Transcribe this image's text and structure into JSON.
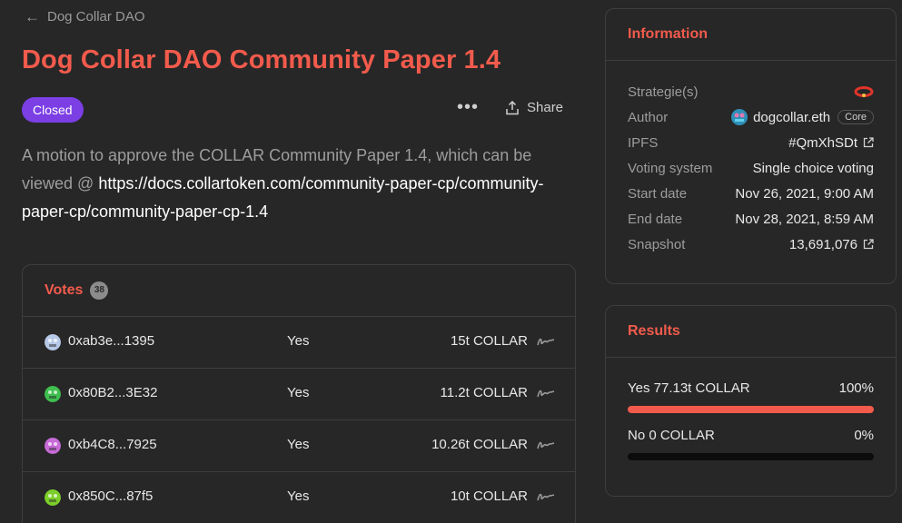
{
  "nav": {
    "back_label": "Dog Collar DAO"
  },
  "proposal": {
    "title": "Dog Collar DAO Community Paper 1.4",
    "status": "Closed",
    "more_label": "•••",
    "share_label": "Share",
    "description_text": "A motion to approve the COLLAR Community Paper 1.4, which can be viewed @ ",
    "description_link": "https://docs.collartoken.com/community-paper-cp/community-paper-cp/community-paper-cp-1.4"
  },
  "votes": {
    "title": "Votes",
    "count": "38",
    "rows": [
      {
        "address": "0xab3e...1395",
        "choice": "Yes",
        "amount": "15t COLLAR",
        "avatar_color": "#b7c9e8"
      },
      {
        "address": "0x80B2...3E32",
        "choice": "Yes",
        "amount": "11.2t COLLAR",
        "avatar_color": "#3fbf4f"
      },
      {
        "address": "0xb4C8...7925",
        "choice": "Yes",
        "amount": "10.26t COLLAR",
        "avatar_color": "#c86ad8"
      },
      {
        "address": "0x850C...87f5",
        "choice": "Yes",
        "amount": "10t COLLAR",
        "avatar_color": "#7ccf2a"
      }
    ]
  },
  "information": {
    "title": "Information",
    "strategies_label": "Strategie(s)",
    "author_label": "Author",
    "author_value": "dogcollar.eth",
    "author_badge": "Core",
    "ipfs_label": "IPFS",
    "ipfs_value": "#QmXhSDt",
    "voting_system_label": "Voting system",
    "voting_system_value": "Single choice voting",
    "start_label": "Start date",
    "start_value": "Nov 26, 2021, 9:00 AM",
    "end_label": "End date",
    "end_value": "Nov 28, 2021, 8:59 AM",
    "snapshot_label": "Snapshot",
    "snapshot_value": "13,691,076"
  },
  "results": {
    "title": "Results",
    "options": [
      {
        "label": "Yes 77.13t COLLAR",
        "percent_label": "100%",
        "fraction": 1.0
      },
      {
        "label": "No 0 COLLAR",
        "percent_label": "0%",
        "fraction": 0.0
      }
    ]
  },
  "colors": {
    "accent": "#f25b4c",
    "badge_closed": "#7b3fe4"
  },
  "icons": [
    "arrow-left-icon",
    "more-icon",
    "share-icon",
    "signature-icon",
    "external-link-icon",
    "strategy-token-icon",
    "author-avatar-icon"
  ]
}
